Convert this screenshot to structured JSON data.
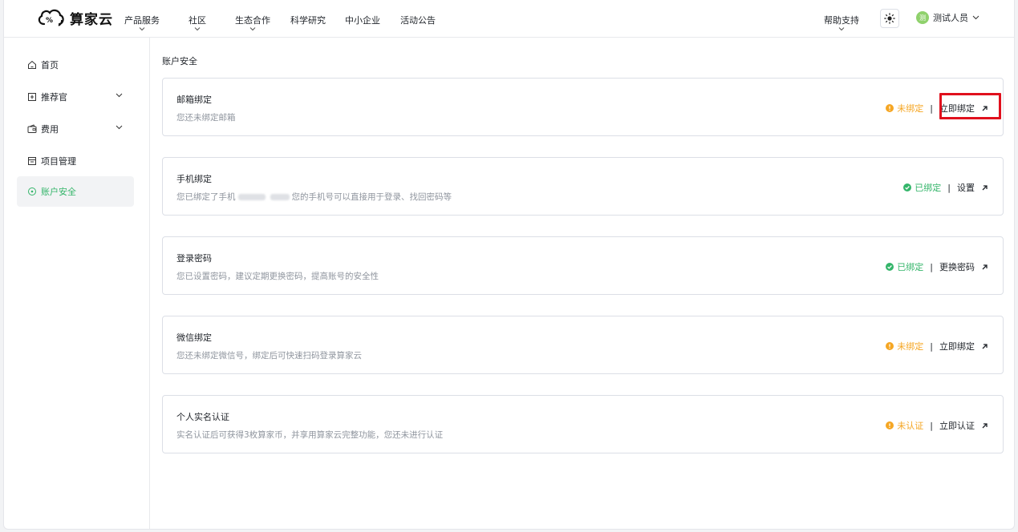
{
  "brand": {
    "name": "算家云"
  },
  "nav": {
    "items": [
      {
        "label": "产品服务",
        "has_dropdown": true
      },
      {
        "label": "社区",
        "has_dropdown": true
      },
      {
        "label": "生态合作",
        "has_dropdown": true
      },
      {
        "label": "科学研究",
        "has_dropdown": false
      },
      {
        "label": "中小企业",
        "has_dropdown": false
      },
      {
        "label": "活动公告",
        "has_dropdown": false
      }
    ],
    "help": {
      "label": "帮助支持",
      "has_dropdown": true
    },
    "theme_icon": "sun-icon",
    "user": {
      "avatar_text": "测",
      "name": "测试人员"
    }
  },
  "sidebar": {
    "items": [
      {
        "label": "首页",
        "icon": "home-icon"
      },
      {
        "label": "推荐官",
        "icon": "badge-icon",
        "expandable": true
      },
      {
        "label": "费用",
        "icon": "wallet-icon",
        "expandable": true
      },
      {
        "label": "项目管理",
        "icon": "folder-icon"
      },
      {
        "label": "账户安全",
        "icon": "shield-icon",
        "active": true
      }
    ]
  },
  "page": {
    "title": "账户安全",
    "cards": [
      {
        "title": "邮箱绑定",
        "desc": "您还未绑定邮箱",
        "status": "未绑定",
        "status_type": "warning",
        "action": "立即绑定"
      },
      {
        "title": "手机绑定",
        "desc_prefix": "您已绑定了手机",
        "desc_suffix": "您的手机号可以直接用于登录、找回密码等",
        "status": "已绑定",
        "status_type": "success",
        "action": "设置"
      },
      {
        "title": "登录密码",
        "desc": "您已设置密码，建议定期更换密码，提高账号的安全性",
        "status": "已绑定",
        "status_type": "success",
        "action": "更换密码"
      },
      {
        "title": "微信绑定",
        "desc": "您还未绑定微信号，绑定后可快速扫码登录算家云",
        "status": "未绑定",
        "status_type": "warning",
        "action": "立即绑定"
      },
      {
        "title": "个人实名认证",
        "desc": "实名认证后可获得3枚算家币，并享用算家云完整功能，您还未进行认证",
        "status": "未认证",
        "status_type": "warning",
        "action": "立即认证"
      }
    ],
    "separator": "|"
  },
  "colors": {
    "accent": "#34b56a",
    "warning": "#f5a623",
    "highlight": "#e0101d"
  }
}
